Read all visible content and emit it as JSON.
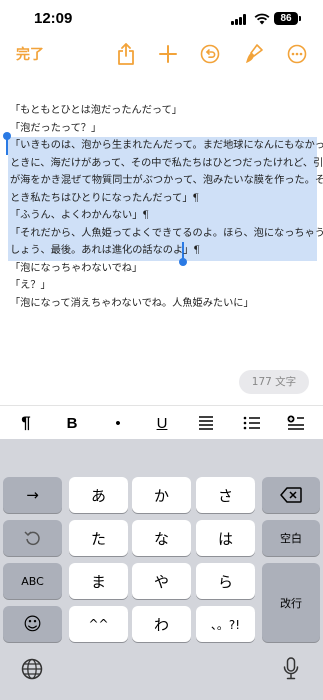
{
  "status_bar": {
    "time": "12:09",
    "battery": "86"
  },
  "toolbar": {
    "done_label": "完了",
    "icons": [
      "share-icon",
      "plus-icon",
      "undo-icon",
      "paintbrush-icon",
      "more-icon"
    ]
  },
  "document": {
    "lines": [
      "「もともとひとは泡だったんだって」",
      "「泡だったって？」",
      "「いきものは、泡から生まれたんだって。まだ地球になんにもなかった",
      "ときに、海だけがあって、その中で私たちはひとつだったけれど、引力",
      "が海をかき混ぜて物質同士がぶつかって、泡みたいな膜を作った。その",
      "とき私たちはひとりになったんだって」¶",
      "「ふうん、よくわかんない」¶",
      "「それだから、人魚姫ってよくできてるのよ。ほら、泡になっちゃうで",
      "しょう、最後。あれは進化の話なのよ」¶",
      "「泡になっちゃわないでね」",
      "「え？」",
      "「泡になって消えちゃわないでね。人魚姫みたいに」"
    ],
    "word_count": "177 文字"
  },
  "format_bar": {
    "paragraph": "¶",
    "bold": "B",
    "bullet": "•",
    "underline": "U"
  },
  "keyboard": {
    "rows": [
      [
        "→",
        "あ",
        "か",
        "さ",
        "⌫"
      ],
      [
        "↺",
        "た",
        "な",
        "は",
        "空白"
      ],
      [
        "ABC",
        "ま",
        "や",
        "ら",
        "改行"
      ],
      [
        "☺",
        "^^",
        "わ",
        "、。?!"
      ]
    ],
    "space_label": "空白",
    "return_label": "改行",
    "abc_label": "ABC"
  }
}
